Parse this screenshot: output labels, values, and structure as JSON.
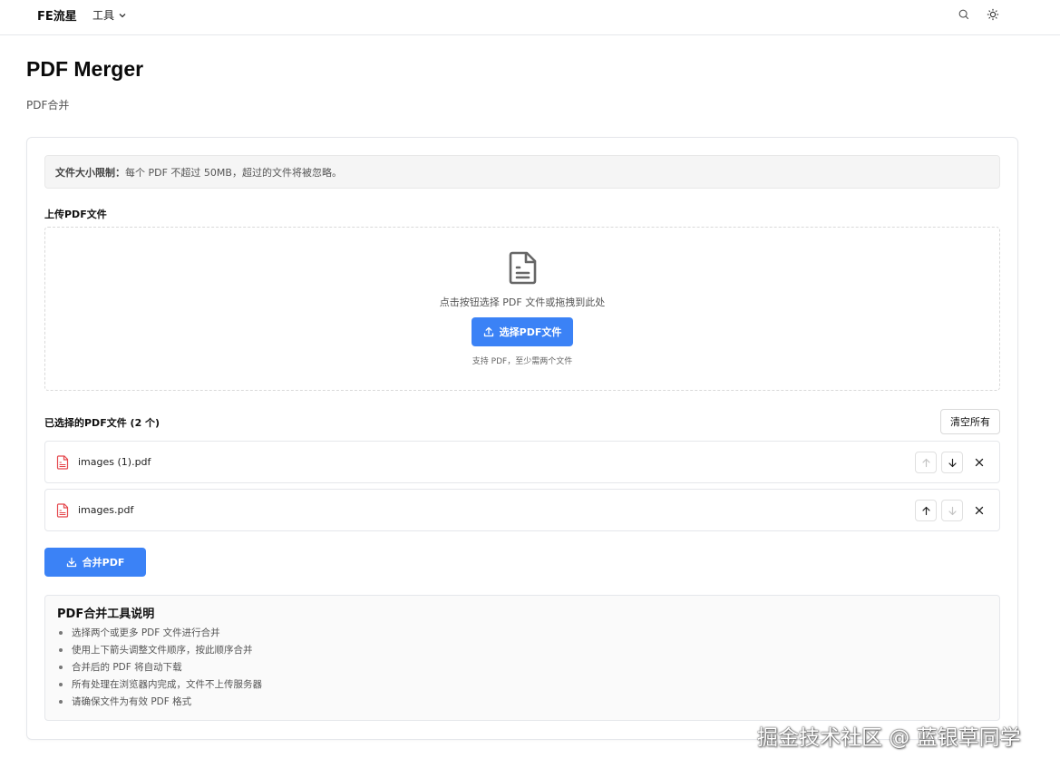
{
  "header": {
    "brand": "FE流星",
    "menu_label": "工具",
    "icons": [
      "search-icon",
      "sun-icon"
    ]
  },
  "page": {
    "title": "PDF Merger",
    "subtitle": "PDF合并"
  },
  "notice": {
    "label": "文件大小限制：",
    "text": "每个 PDF 不超过 50MB，超过的文件将被忽略。"
  },
  "upload": {
    "label": "上传PDF文件",
    "hint": "点击按钮选择 PDF 文件或拖拽到此处",
    "button_label": "选择PDF文件",
    "support_text": "支持 PDF，至少需两个文件"
  },
  "selected": {
    "label": "已选择的PDF文件 (2 个)",
    "clear_label": "清空所有",
    "files": [
      {
        "name": "images (1).pdf",
        "up_enabled": false,
        "down_enabled": true
      },
      {
        "name": "images.pdf",
        "up_enabled": true,
        "down_enabled": false
      }
    ]
  },
  "merge": {
    "button_label": "合并PDF"
  },
  "info": {
    "title": "PDF合并工具说明",
    "items": [
      "选择两个或更多 PDF 文件进行合并",
      "使用上下箭头调整文件顺序，按此顺序合并",
      "合并后的 PDF 将自动下载",
      "所有处理在浏览器内完成，文件不上传服务器",
      "请确保文件为有效 PDF 格式"
    ]
  },
  "watermark": "掘金技术社区 @ 蓝银草同学",
  "colors": {
    "primary": "#3b82f6",
    "pdf_icon": "#e5484d",
    "border": "#e5e7eb"
  }
}
